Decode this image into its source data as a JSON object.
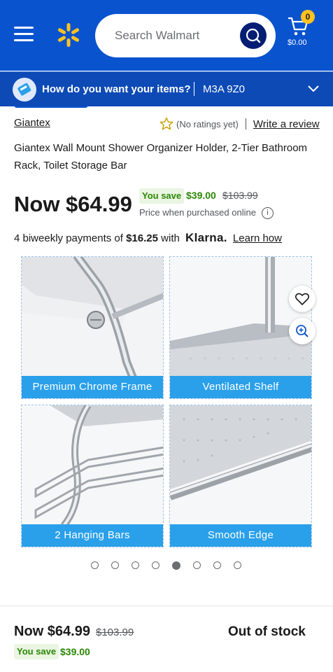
{
  "header": {
    "search_placeholder": "Search Walmart",
    "cart_count": "0",
    "cart_total": "$0.00"
  },
  "delivery": {
    "question": "How do you want your items?",
    "postal_code": "M3A 9Z0"
  },
  "product": {
    "brand": "Giantex",
    "no_ratings": "(No ratings yet)",
    "write_review": "Write a review",
    "title": "Giantex Wall Mount Shower Organizer Holder, 2-Tier Bathroom Rack, Toilet Storage Bar",
    "now_price": "Now $64.99",
    "you_save_label": "You save",
    "you_save_amount": "$39.00",
    "was_price": "$103.99",
    "online_note": "Price when purchased online",
    "info_glyph": "i"
  },
  "klarna": {
    "prefix": "4 biweekly payments of",
    "amount": "$16.25",
    "with": "with",
    "brand": "Klarna.",
    "learn_how": "Learn how"
  },
  "gallery": {
    "tiles": [
      {
        "label": "Premium Chrome Frame"
      },
      {
        "label": "Ventilated Shelf"
      },
      {
        "label": "2 Hanging Bars"
      },
      {
        "label": "Smooth Edge"
      }
    ],
    "dot_count": 8,
    "active_dot": 5
  },
  "bottom_bar": {
    "now_price": "Now $64.99",
    "was_price": "$103.99",
    "you_save_label": "You save",
    "you_save_amount": "$39.00",
    "status": "Out of stock"
  },
  "colors": {
    "header_blue": "#0a53cf",
    "spark_yellow": "#ffc220",
    "save_green": "#2a8703",
    "label_blue": "#2aa0ea"
  },
  "icons": [
    "menu-icon",
    "walmart-spark-icon",
    "search-icon",
    "cart-icon",
    "delivery-icon",
    "chevron-down-icon",
    "star-outline-icon",
    "info-icon",
    "heart-icon",
    "zoom-icon"
  ]
}
